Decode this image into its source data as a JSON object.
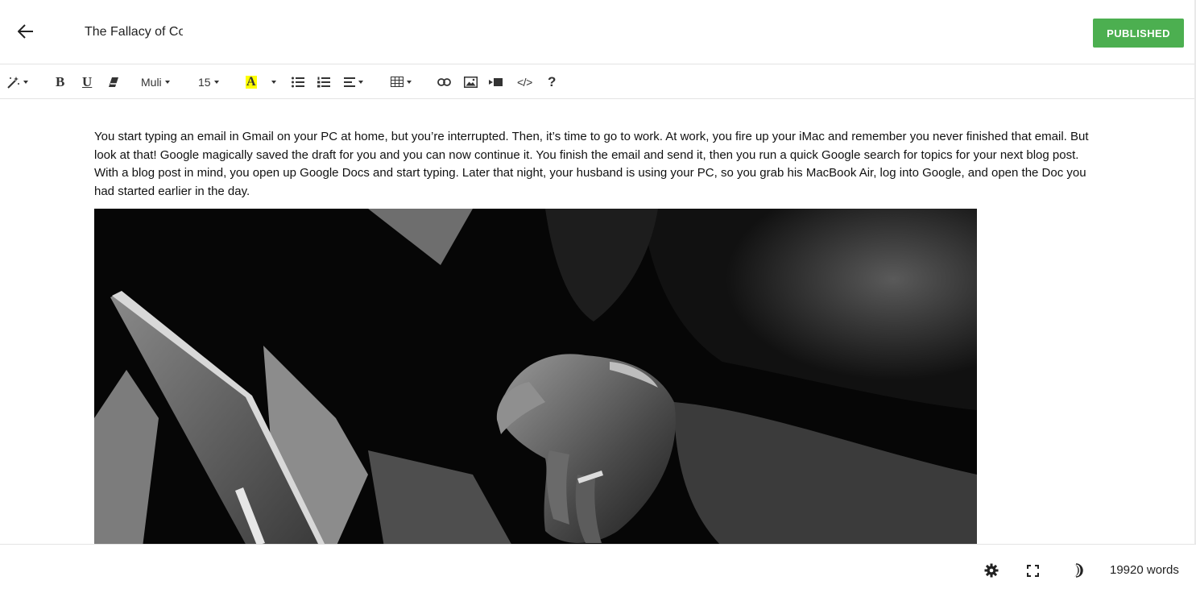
{
  "header": {
    "title_value": "The Fallacy of Co",
    "publish_label": "PUBLISHED"
  },
  "toolbar": {
    "font_family": "Muli",
    "font_size": "15",
    "bold_label": "B",
    "underline_label": "U",
    "highlight_label": "A",
    "code_label": "</>",
    "help_label": "?",
    "highlight_color": "#ffff00"
  },
  "content": {
    "paragraph": "You start typing an email in Gmail on your PC at home, but you’re interrupted. Then, it’s time to go to work. At work, you fire up your iMac and remember you never finished that email. But look at that! Google magically saved the draft for you and you can now continue it. You finish the email and send it, then you run a quick Google search for topics for your next blog post. With a blog post in mind, you open up Google Docs and start typing. Later that night, your husband is using your PC, so you grab his MacBook Air, log into Google, and open the Doc you had started earlier in the day."
  },
  "footer": {
    "word_count": "19920 words"
  },
  "colors": {
    "publish_bg": "#4caf50",
    "border": "#e4e4e4"
  },
  "icons": [
    "arrow-left-icon",
    "magic-wand-icon",
    "eraser-icon",
    "bulleted-list-icon",
    "numbered-list-icon",
    "align-icon",
    "table-icon",
    "link-icon",
    "image-icon",
    "video-icon",
    "gear-icon",
    "fullscreen-icon",
    "dark-mode-icon"
  ]
}
